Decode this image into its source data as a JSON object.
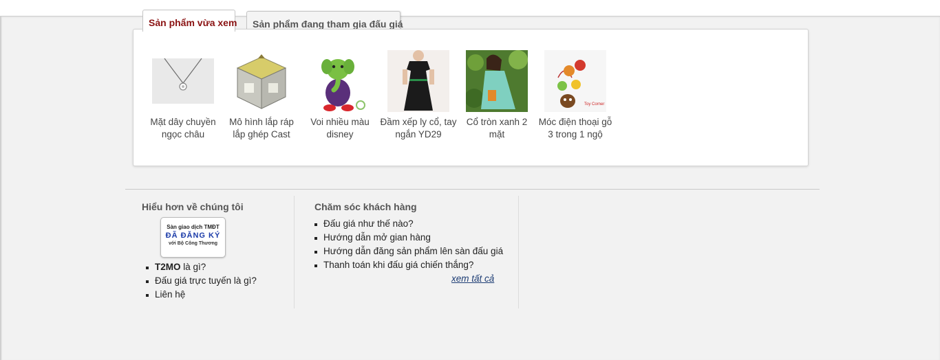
{
  "tabs": {
    "viewed": "Sản phẩm vừa xem",
    "bidding": "Sản phẩm đang tham gia đấu giá"
  },
  "products": [
    {
      "name": "Mặt dây chuyền ngọc châu",
      "image": "pendant-necklace"
    },
    {
      "name": "Mô hình lắp ráp lắp ghép Cast",
      "image": "puzzle-cube"
    },
    {
      "name": "Voi nhiều màu disney",
      "image": "plush-elephant"
    },
    {
      "name": "Đầm xếp ly cổ, tay ngắn YD29",
      "image": "black-dress"
    },
    {
      "name": "Cổ tròn xanh 2 mặt",
      "image": "green-top-model"
    },
    {
      "name": "Móc điện thoại gỗ 3 trong 1 ngộ",
      "image": "wooden-phone-charms",
      "image_caption": "Toy Corner"
    }
  ],
  "footer": {
    "about": {
      "heading": "Hiểu hơn về chúng tôi",
      "badge": {
        "line1": "Sàn giao dịch TMĐT",
        "line2": "ĐÃ ĐĂNG KÝ",
        "line3": "với Bộ Công Thương"
      },
      "links": [
        {
          "bold": "T2MO",
          "rest": " là gì?"
        },
        {
          "bold": "",
          "rest": "Đấu giá trực tuyến là gì?"
        },
        {
          "bold": "",
          "rest": "Liên hệ"
        }
      ]
    },
    "support": {
      "heading": "Chăm sóc khách hàng",
      "links": [
        "Đấu giá như thế nào?",
        "Hướng dẫn mở gian hàng",
        "Hướng dẫn đăng sản phẩm lên sàn đấu giá",
        "Thanh toán khi đấu giá chiến thắng?"
      ],
      "see_all": "xem tất cả"
    }
  }
}
